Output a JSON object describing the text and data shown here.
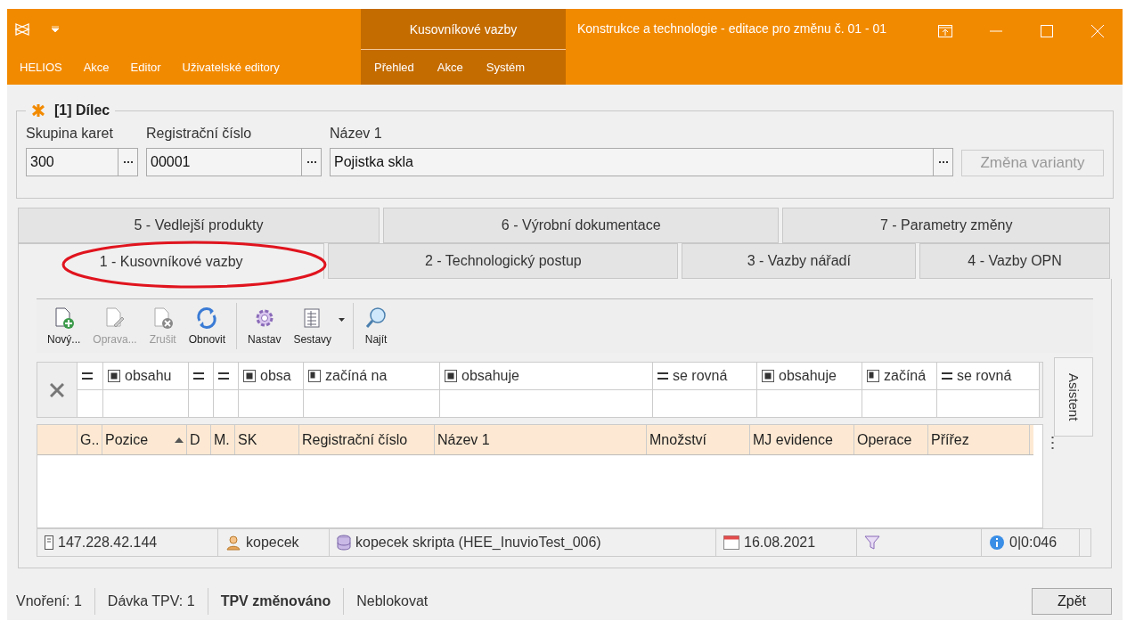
{
  "window": {
    "title": "Konstrukce a technologie - editace pro změnu č. 01 - 01"
  },
  "ribbon": {
    "tabs": [
      "HELIOS",
      "Akce",
      "Editor",
      "Uživatelské editory"
    ],
    "context_group": {
      "title": "Kusovníkové vazby",
      "tabs": [
        "Přehled",
        "Akce",
        "Systém"
      ]
    }
  },
  "group": {
    "title": "[1] Dílec",
    "fields": [
      {
        "label": "Skupina karet",
        "value": "300"
      },
      {
        "label": "Registrační číslo",
        "value": "00001"
      },
      {
        "label": "Název 1",
        "value": "Pojistka skla"
      }
    ],
    "button": {
      "label": "Změna varianty",
      "disabled": true
    }
  },
  "tab_rows": [
    [
      {
        "label": "5 - Vedlejší produkty",
        "selected": false,
        "circled": false
      },
      {
        "label": "6 - Výrobní dokumentace",
        "selected": false,
        "circled": false
      },
      {
        "label": "7 - Parametry změny",
        "selected": false,
        "circled": false
      }
    ],
    [
      {
        "label": "1 - Kusovníkové vazby",
        "selected": true,
        "circled": true
      },
      {
        "label": "2 - Technologický postup",
        "selected": false,
        "circled": false
      },
      {
        "label": "3 - Vazby nářadí",
        "selected": false,
        "circled": false
      },
      {
        "label": "4 - Vazby OPN",
        "selected": false,
        "circled": false
      }
    ]
  ],
  "toolbar": [
    [
      {
        "label": "Nový...",
        "disabled": false
      },
      {
        "label": "Oprava...",
        "disabled": true
      },
      {
        "label": "Zrušit",
        "disabled": true
      },
      {
        "label": "Obnovit",
        "disabled": false
      }
    ],
    [
      {
        "label": "Nastav",
        "disabled": false
      },
      {
        "label": "Sestavy",
        "disabled": false,
        "dropdown": true
      }
    ],
    [
      {
        "label": "Najít",
        "disabled": false
      }
    ]
  ],
  "filters": [
    {
      "kind": "equals"
    },
    {
      "kind": "contains",
      "label": "obsahu"
    },
    {
      "kind": "equals"
    },
    {
      "kind": "equals"
    },
    {
      "kind": "contains",
      "label": "obsa"
    },
    {
      "kind": "starts",
      "label": "začíná na"
    },
    {
      "kind": "contains",
      "label": "obsahuje"
    },
    {
      "kind": "equals",
      "label": "se rovná"
    },
    {
      "kind": "contains",
      "label": "obsahuje"
    },
    {
      "kind": "starts",
      "label": "začíná"
    },
    {
      "kind": "equals",
      "label": "se rovná"
    }
  ],
  "table": {
    "columns": [
      {
        "label": "G.."
      },
      {
        "label": "Pozice",
        "sorted": true
      },
      {
        "label": "D"
      },
      {
        "label": "M."
      },
      {
        "label": "SK"
      },
      {
        "label": "Registrační číslo"
      },
      {
        "label": "Název 1"
      },
      {
        "label": "Množství"
      },
      {
        "label": "MJ evidence"
      },
      {
        "label": "Operace"
      },
      {
        "label": "Přířez"
      }
    ]
  },
  "side_tab": "Asistent",
  "status_bar": [
    {
      "kind": "server",
      "text": "147.228.42.144"
    },
    {
      "kind": "user",
      "text": "kopecek"
    },
    {
      "kind": "database",
      "text": "kopecek skripta (HEE_InuvioTest_006)"
    },
    {
      "kind": "date",
      "text": "16.08.2021"
    },
    {
      "kind": "filter"
    },
    {
      "kind": "info",
      "text": "0|0:046"
    }
  ],
  "footer": {
    "items": [
      {
        "text": "Vnoření: 1",
        "bold": false
      },
      {
        "text": "Dávka TPV: 1",
        "bold": false
      },
      {
        "text": "TPV změnováno",
        "bold": true
      },
      {
        "text": "Neblokovat",
        "bold": false
      }
    ],
    "button": "Zpět"
  }
}
